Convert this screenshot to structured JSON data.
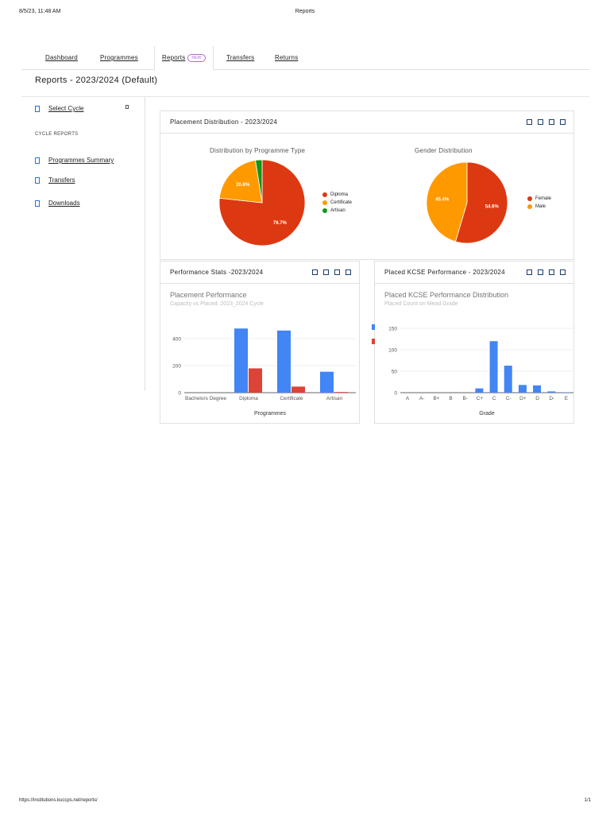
{
  "print": {
    "timestamp": "8/5/23, 11:48 AM",
    "title": "Reports",
    "url": "https://institutions.kuccps.net/reports/",
    "page": "1/1"
  },
  "tabs": [
    {
      "label": "Dashboard"
    },
    {
      "label": "Programmes"
    },
    {
      "label": "Reports",
      "badge": "NEW"
    },
    {
      "label": "Transfers"
    },
    {
      "label": "Returns"
    }
  ],
  "page_title": "Reports - 2023/2024 (Default)",
  "sidebar": {
    "select_cycle": "Select Cycle",
    "caption": "CYCLE REPORTS",
    "items": [
      {
        "label": "Programmes Summary"
      },
      {
        "label": "Transfers"
      },
      {
        "label": "Downloads"
      }
    ]
  },
  "colors": {
    "blue": "#4285f4",
    "red": "#db4437",
    "orange": "#ff9900",
    "pie_red": "#dc3912",
    "green": "#109618",
    "badge": "#b06ac8"
  },
  "cards": {
    "placement": {
      "title": "Placement Distribution - 2023/2024"
    },
    "performance": {
      "title": "Performance Stats -2023/2024",
      "chart_title": "Placement Performance",
      "chart_subtitle": "Capacity vs Placed: 2023_2024 Cycle"
    },
    "kcse": {
      "title": "Placed KCSE Performance - 2023/2024",
      "chart_title": "Placed KCSE Performance Distribution",
      "chart_subtitle": "Placed Count on Mead Grade"
    }
  },
  "chart_data": [
    {
      "type": "pie",
      "title": "Distribution by Programme Type",
      "categories": [
        "Diploma",
        "Certificate",
        "Artisan"
      ],
      "values": [
        76.7,
        20.8,
        2.5
      ],
      "labels": [
        "76.7%",
        "20.8%",
        ""
      ],
      "colors": [
        "#dc3912",
        "#ff9900",
        "#109618"
      ],
      "legend": "right"
    },
    {
      "type": "pie",
      "title": "Gender Distribution",
      "categories": [
        "Female",
        "Male"
      ],
      "values": [
        54.6,
        45.4
      ],
      "labels": [
        "54.6%",
        "45.4%"
      ],
      "colors": [
        "#dc3912",
        "#ff9900"
      ],
      "legend": "right"
    },
    {
      "type": "bar",
      "categories": [
        "Bachelors Degree",
        "Diploma",
        "Certificate",
        "Artisan"
      ],
      "series": [
        {
          "values": [
            0,
            475,
            460,
            155
          ],
          "color": "#4285f4"
        },
        {
          "values": [
            0,
            180,
            45,
            5
          ],
          "color": "#db4437"
        }
      ],
      "xlabel": "Programmes",
      "yticks": [
        0,
        200,
        400
      ],
      "ylim": [
        0,
        500
      ],
      "grid": true
    },
    {
      "type": "bar",
      "categories": [
        "A",
        "A-",
        "B+",
        "B",
        "B-",
        "C+",
        "C",
        "C-",
        "D+",
        "D",
        "D-",
        "E"
      ],
      "values": [
        0,
        0,
        0,
        0,
        0,
        10,
        120,
        63,
        18,
        17,
        3,
        1
      ],
      "color": "#4285f4",
      "xlabel": "Grade",
      "yticks": [
        0,
        50,
        100,
        150
      ],
      "ylim": [
        0,
        150
      ],
      "grid": true
    }
  ]
}
